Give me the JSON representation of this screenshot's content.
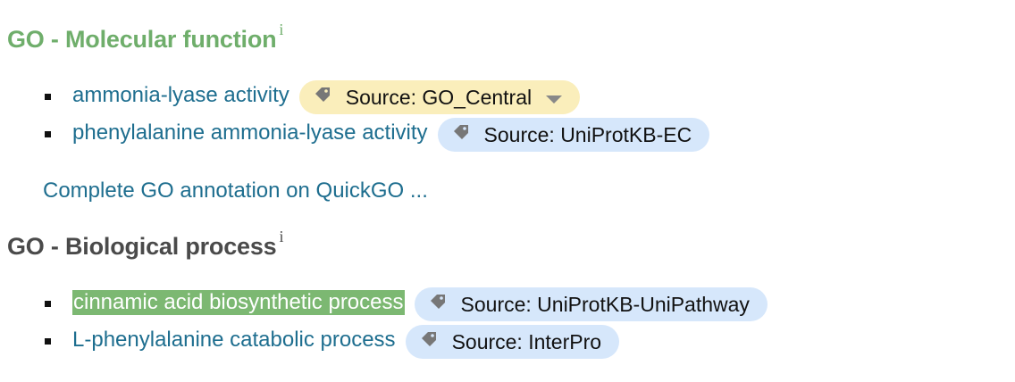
{
  "molecular_function": {
    "heading": "GO - Molecular function",
    "info_marker": "i",
    "terms": [
      {
        "label": "ammonia-lyase activity",
        "source": "Source: GO_Central",
        "source_style": "yellow",
        "has_dropdown": true
      },
      {
        "label": "phenylalanine ammonia-lyase activity",
        "source": "Source: UniProtKB-EC",
        "source_style": "blue",
        "has_dropdown": false
      }
    ],
    "complete_link": "Complete GO annotation on QuickGO ..."
  },
  "biological_process": {
    "heading": "GO - Biological process",
    "info_marker": "i",
    "terms": [
      {
        "label": "cinnamic acid biosynthetic process",
        "source": "Source: UniProtKB-UniPathway",
        "source_style": "blue",
        "highlighted": true
      },
      {
        "label": "L-phenylalanine catabolic process",
        "source": "Source: InterPro",
        "source_style": "blue",
        "highlighted": false
      }
    ]
  },
  "colors": {
    "mf_heading": "#6fae6b",
    "bp_heading": "#4a4a4a",
    "link": "#1e6e8f",
    "highlight_bg": "#7cb872",
    "pill_yellow": "#faeebb",
    "pill_blue": "#d6e7fb"
  },
  "icons": {
    "source_tag": "tag-icon",
    "dropdown": "chevron-down-icon"
  }
}
